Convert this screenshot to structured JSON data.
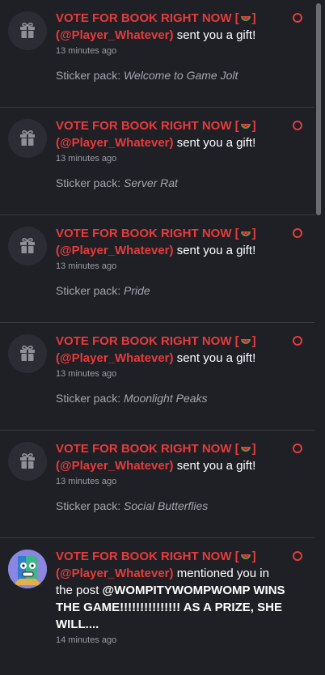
{
  "notifications": [
    {
      "title": "VOTE FOR BOOK RIGHT NOW [",
      "title_end": "]",
      "user": "(@Player_Whatever)",
      "action": "sent you a gift!",
      "time": "13 minutes ago",
      "detail_prefix": "Sticker pack:",
      "detail_name": "Welcome to Game Jolt",
      "avatar_icon": "gift-icon"
    },
    {
      "title": "VOTE FOR BOOK RIGHT NOW [",
      "title_end": "]",
      "user": "(@Player_Whatever)",
      "action": "sent you a gift!",
      "time": "13 minutes ago",
      "detail_prefix": "Sticker pack:",
      "detail_name": "Server Rat",
      "avatar_icon": "gift-icon"
    },
    {
      "title": "VOTE FOR BOOK RIGHT NOW [",
      "title_end": "]",
      "user": "(@Player_Whatever)",
      "action": "sent you a gift!",
      "time": "13 minutes ago",
      "detail_prefix": "Sticker pack:",
      "detail_name": "Pride",
      "avatar_icon": "gift-icon"
    },
    {
      "title": "VOTE FOR BOOK RIGHT NOW [",
      "title_end": "]",
      "user": "(@Player_Whatever)",
      "action": "sent you a gift!",
      "time": "13 minutes ago",
      "detail_prefix": "Sticker pack:",
      "detail_name": "Moonlight Peaks",
      "avatar_icon": "gift-icon"
    },
    {
      "title": "VOTE FOR BOOK RIGHT NOW [",
      "title_end": "]",
      "user": "(@Player_Whatever)",
      "action": "sent you a gift!",
      "time": "13 minutes ago",
      "detail_prefix": "Sticker pack:",
      "detail_name": "Social Butterflies",
      "avatar_icon": "gift-icon"
    }
  ],
  "mention": {
    "title": "VOTE FOR BOOK RIGHT NOW [",
    "title_end": "]",
    "user": "(@Player_Whatever)",
    "action_1": "mentioned you in",
    "action_2": "the post",
    "post": "@WOMPITYWOMPWOMP WINS THE GAME!!!!!!!!!!!!!!! AS A PRIZE, SHE WILL....",
    "time": "14 minutes ago"
  },
  "colors": {
    "accent": "#e63b3b",
    "background": "#1f2026",
    "divider": "#3a3b42"
  }
}
